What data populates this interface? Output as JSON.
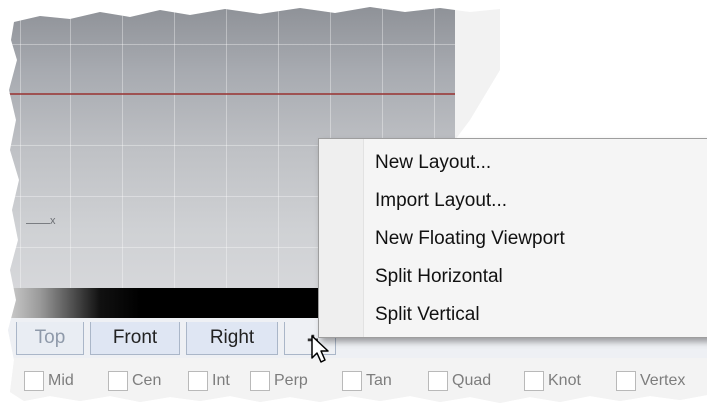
{
  "viewport": {
    "axis_label": "x"
  },
  "tabs": [
    {
      "label": "Top",
      "active": false
    },
    {
      "label": "Front",
      "active": true
    },
    {
      "label": "Right",
      "active": true
    }
  ],
  "add_tab_icon": "plus-icon",
  "context_menu": {
    "items": [
      "New Layout...",
      "Import Layout...",
      "New Floating Viewport",
      "Split Horizontal",
      "Split Vertical"
    ]
  },
  "osnap": {
    "items": [
      "Mid",
      "Cen",
      "Int",
      "Perp",
      "Tan",
      "Quad",
      "Knot",
      "Vertex"
    ]
  },
  "colors": {
    "axis_red": "#9a3a3a",
    "tab_active_bg": "#dfe6f3",
    "menu_bg": "#f5f5f5"
  },
  "cursor": "arrow-cursor-icon"
}
